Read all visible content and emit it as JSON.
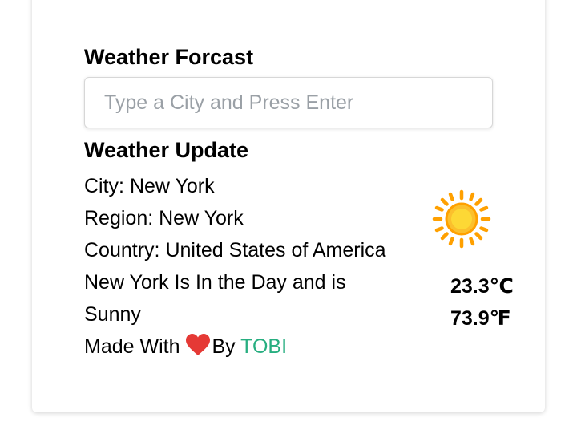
{
  "header": {
    "title": "Weather Forcast"
  },
  "search": {
    "placeholder": "Type a City and Press Enter",
    "value": ""
  },
  "update": {
    "title": "Weather Update",
    "city_label": "City: ",
    "city": "New York",
    "region_label": "Region: ",
    "region": "New York",
    "country_label": "Country: ",
    "country": "United States of America",
    "daytime_text": "New York Is In the Day and is",
    "condition": "Sunny"
  },
  "temperature": {
    "celsius": "23.3℃",
    "fahrenheit": "73.9℉"
  },
  "footer": {
    "made_with": "Made With",
    "by": "By",
    "author": "TOBI"
  },
  "icons": {
    "weather": "sun-icon",
    "love": "heart-icon"
  },
  "colors": {
    "author": "#27ae80",
    "heart": "#e53935",
    "sun_core": "#fbc02d",
    "sun_rays": "#ffa000"
  }
}
